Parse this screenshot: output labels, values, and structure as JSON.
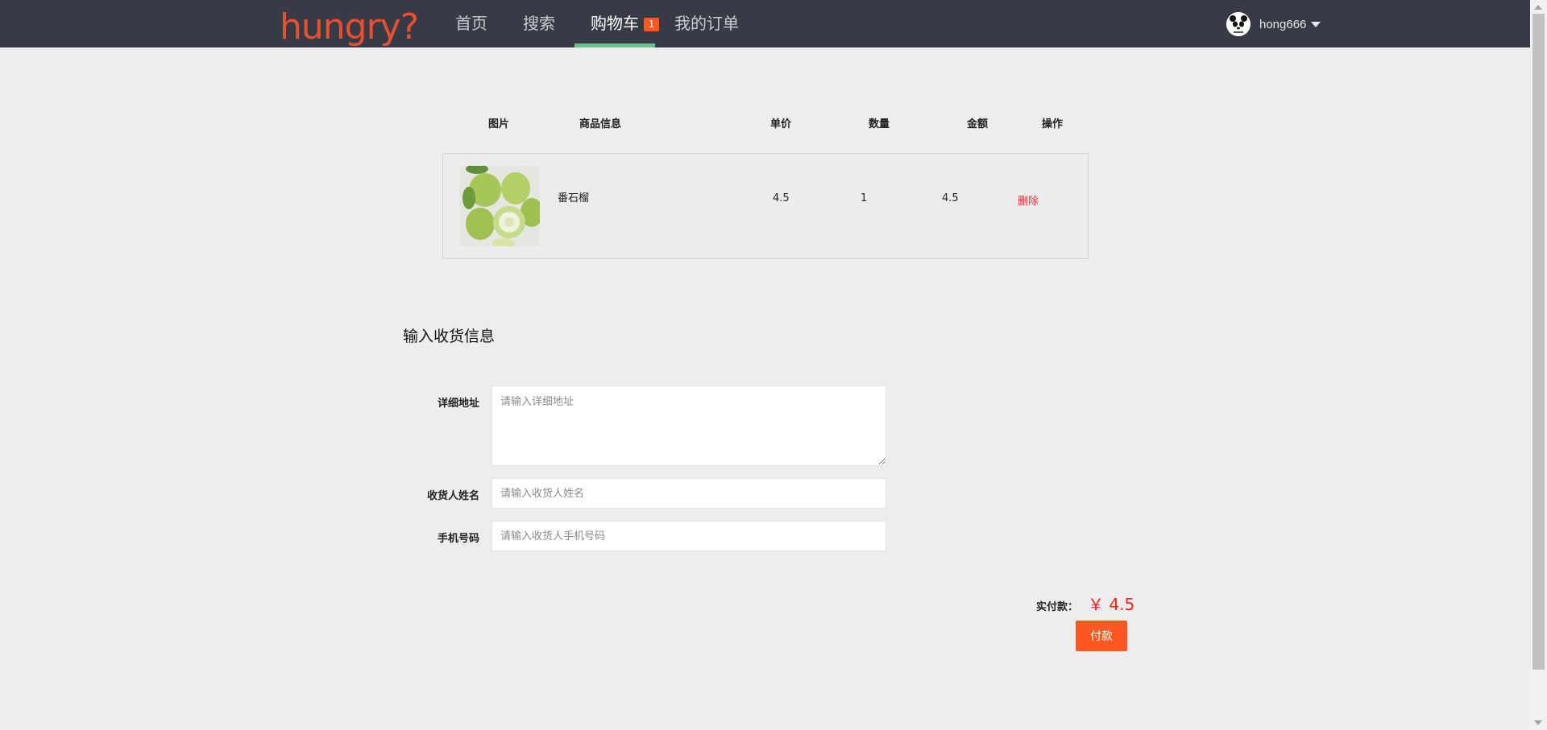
{
  "nav": {
    "logo_text": "hungry?",
    "items": [
      {
        "label": "首页"
      },
      {
        "label": "搜索"
      },
      {
        "label": "购物车"
      },
      {
        "label": "我的订单"
      }
    ],
    "cart_count": "1",
    "username": "hong666"
  },
  "cart": {
    "headers": {
      "image": "图片",
      "info": "商品信息",
      "unit_price": "单价",
      "quantity": "数量",
      "amount": "金额",
      "action": "操作"
    },
    "items": [
      {
        "name": "番石榴",
        "unit_price": "4.5",
        "quantity": "1",
        "amount": "4.5",
        "action_label": "删除"
      }
    ]
  },
  "shipping": {
    "title": "输入收货信息",
    "address_label": "详细地址",
    "address_placeholder": "请输入详细地址",
    "name_label": "收货人姓名",
    "name_placeholder": "请输入收货人姓名",
    "phone_label": "手机号码",
    "phone_placeholder": "请输入收货人手机号码"
  },
  "payment": {
    "label": "实付款：",
    "amount": "￥ 4.5",
    "button_label": "付款"
  },
  "colors": {
    "nav_bg": "#383b46",
    "active_underline": "#67c18b",
    "accent": "#ff5722",
    "price_red": "#ff1d1d"
  }
}
